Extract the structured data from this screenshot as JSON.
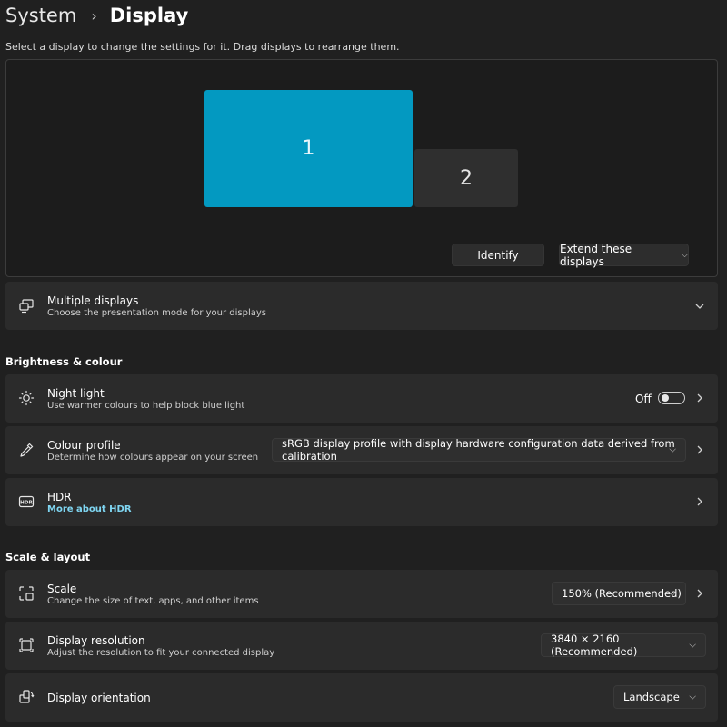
{
  "header": {
    "parent": "System",
    "current": "Display",
    "intro": "Select a display to change the settings for it. Drag displays to rearrange them."
  },
  "arrangement": {
    "monitors": [
      {
        "label": "1",
        "selected": true
      },
      {
        "label": "2",
        "selected": false
      }
    ],
    "identify_label": "Identify",
    "extend_label": "Extend these displays"
  },
  "multiple_displays": {
    "title": "Multiple displays",
    "subtitle": "Choose the presentation mode for your displays",
    "icon": "multi-monitor-icon"
  },
  "sections": {
    "brightness": "Brightness & colour",
    "scale_layout": "Scale & layout"
  },
  "night_light": {
    "title": "Night light",
    "subtitle": "Use warmer colours to help block blue light",
    "state_label": "Off",
    "on": false,
    "icon": "brightness-icon"
  },
  "colour_profile": {
    "title": "Colour profile",
    "subtitle": "Determine how colours appear on your screen",
    "value": "sRGB display profile with display hardware configuration data derived from calibration",
    "icon": "eyedropper-icon"
  },
  "hdr": {
    "title": "HDR",
    "link": "More about HDR",
    "icon": "hdr-icon"
  },
  "scale": {
    "title": "Scale",
    "subtitle": "Change the size of text, apps, and other items",
    "value": "150% (Recommended)",
    "icon": "scale-icon"
  },
  "resolution": {
    "title": "Display resolution",
    "subtitle": "Adjust the resolution to fit your connected display",
    "value": "3840 × 2160 (Recommended)",
    "icon": "resolution-icon"
  },
  "orientation": {
    "title": "Display orientation",
    "value": "Landscape",
    "icon": "orientation-icon"
  },
  "colors": {
    "accent": "#0399c1",
    "background": "#202020",
    "card": "#2b2b2b",
    "link": "#7fd6f2"
  }
}
